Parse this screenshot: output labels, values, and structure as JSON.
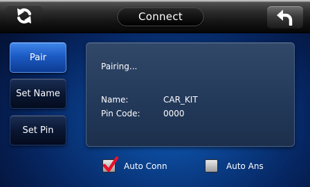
{
  "header": {
    "title": "Connect",
    "left_icon": "refresh-arrows-icon",
    "right_icon": "back-arrow-icon"
  },
  "menu": {
    "items": [
      {
        "label": "Pair",
        "active": true
      },
      {
        "label": "Set Name",
        "active": false
      },
      {
        "label": "Set Pin",
        "active": false
      }
    ]
  },
  "panel": {
    "status": "Pairing...",
    "name_label": "Name:",
    "name_value": "CAR_KIT",
    "pin_label": "Pin Code:",
    "pin_value": "0000"
  },
  "options": {
    "auto_conn": {
      "label": "Auto Conn",
      "checked": true
    },
    "auto_ans": {
      "label": "Auto Ans",
      "checked": false
    }
  },
  "colors": {
    "active_button": "#1c5bc4",
    "checkmark": "#e8102a",
    "background_blue": "#0a3f8a"
  }
}
